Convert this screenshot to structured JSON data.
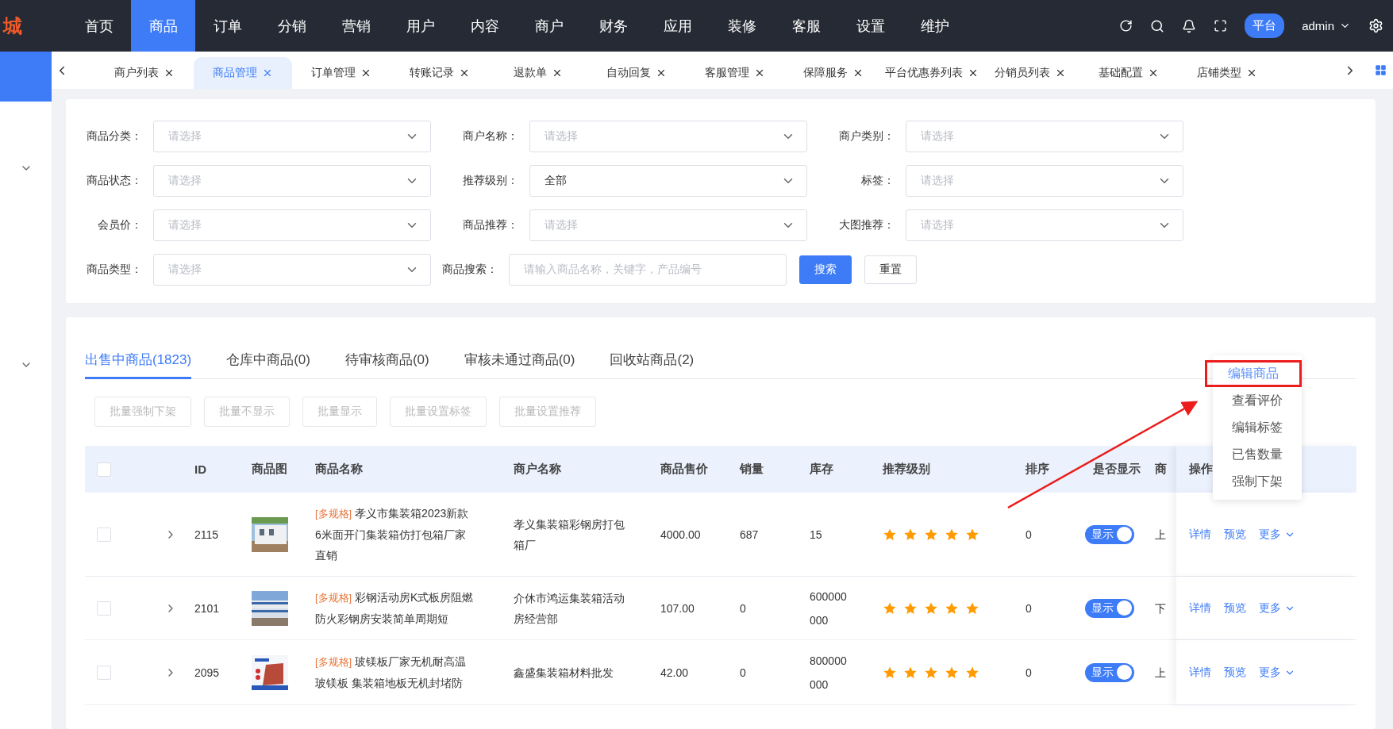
{
  "logo": "城",
  "top_nav": {
    "items": [
      {
        "label": "首页",
        "selected": false
      },
      {
        "label": "商品",
        "selected": true
      },
      {
        "label": "订单",
        "selected": false
      },
      {
        "label": "分销",
        "selected": false
      },
      {
        "label": "营销",
        "selected": false
      },
      {
        "label": "用户",
        "selected": false
      },
      {
        "label": "内容",
        "selected": false
      },
      {
        "label": "商户",
        "selected": false
      },
      {
        "label": "财务",
        "selected": false
      },
      {
        "label": "应用",
        "selected": false
      },
      {
        "label": "装修",
        "selected": false
      },
      {
        "label": "客服",
        "selected": false
      },
      {
        "label": "设置",
        "selected": false
      },
      {
        "label": "维护",
        "selected": false
      }
    ],
    "badge": "平台",
    "user": "admin"
  },
  "page_tabs": [
    {
      "label": "商户列表",
      "selected": false
    },
    {
      "label": "商品管理",
      "selected": true
    },
    {
      "label": "订单管理",
      "selected": false
    },
    {
      "label": "转账记录",
      "selected": false
    },
    {
      "label": "退款单",
      "selected": false
    },
    {
      "label": "自动回复",
      "selected": false
    },
    {
      "label": "客服管理",
      "selected": false
    },
    {
      "label": "保障服务",
      "selected": false
    },
    {
      "label": "平台优惠券列表",
      "selected": false
    },
    {
      "label": "分销员列表",
      "selected": false
    },
    {
      "label": "基础配置",
      "selected": false
    },
    {
      "label": "店铺类型",
      "selected": false
    }
  ],
  "filters": [
    {
      "label": "商品分类：",
      "kind": "select",
      "placeholder": "请选择"
    },
    {
      "label": "商户名称：",
      "kind": "select",
      "placeholder": "请选择"
    },
    {
      "label": "商户类别：",
      "kind": "select",
      "placeholder": "请选择"
    },
    {
      "label": "商品状态：",
      "kind": "select",
      "placeholder": "请选择"
    },
    {
      "label": "推荐级别：",
      "kind": "select",
      "value": "全部"
    },
    {
      "label": "标签：",
      "kind": "select",
      "placeholder": "请选择"
    },
    {
      "label": "会员价：",
      "kind": "select",
      "placeholder": "请选择"
    },
    {
      "label": "商品推荐：",
      "kind": "select",
      "placeholder": "请选择"
    },
    {
      "label": "大图推荐：",
      "kind": "select",
      "placeholder": "请选择"
    },
    {
      "label": "商品类型：",
      "kind": "select",
      "placeholder": "请选择"
    },
    {
      "label": "商品搜索：",
      "kind": "input",
      "placeholder": "请输入商品名称，关键字，产品编号"
    }
  ],
  "filter_buttons": [
    {
      "label": "搜索",
      "kind": "primary"
    },
    {
      "label": "重置",
      "kind": "default"
    }
  ],
  "product_tabs": [
    {
      "label": "出售中商品(1823)",
      "selected": true
    },
    {
      "label": "仓库中商品(0)",
      "selected": false
    },
    {
      "label": "待审核商品(0)",
      "selected": false
    },
    {
      "label": "审核未通过商品(0)",
      "selected": false
    },
    {
      "label": "回收站商品(2)",
      "selected": false
    }
  ],
  "batch_buttons": [
    {
      "label": "批量强制下架",
      "disabled": true
    },
    {
      "label": "批量不显示",
      "disabled": true
    },
    {
      "label": "批量显示",
      "disabled": true
    },
    {
      "label": "批量设置标签",
      "disabled": true
    },
    {
      "label": "批量设置推荐",
      "disabled": true
    }
  ],
  "table": {
    "checked": false,
    "columns": [
      "ID",
      "商品图",
      "商品名称",
      "商户名称",
      "商品售价",
      "销量",
      "库存",
      "推荐级别",
      "排序",
      "是否显示",
      "商",
      "操作"
    ],
    "rows": [
      {
        "checked": false,
        "id": "2115",
        "tag": "[多规格]",
        "name": "孝义市集装箱2023新款6米面开门集装箱仿打包箱厂家直销",
        "merchant": "孝义集装箱彩钢房打包箱厂",
        "price": "4000.00",
        "sales": "687",
        "stock": "15",
        "stars": 5,
        "sort": "0",
        "display": {
          "on": true,
          "label": "显示"
        },
        "column_11": "上",
        "actions": [
          "详情",
          "预览",
          "更多"
        ]
      },
      {
        "checked": false,
        "id": "2101",
        "tag": "[多规格]",
        "name": "彩钢活动房K式板房阻燃防火彩钢房安装简单周期短",
        "merchant": "介休市鸿运集装箱活动房经营部",
        "price": "107.00",
        "sales": "0",
        "stock": "600000000",
        "stars": 5,
        "sort": "0",
        "display": {
          "on": true,
          "label": "显示"
        },
        "column_11": "下",
        "actions": [
          "详情",
          "预览",
          "更多"
        ]
      },
      {
        "checked": false,
        "id": "2095",
        "tag": "[多规格]",
        "name": "玻镁板厂家无机耐高温玻镁板 集装箱地板无机封堵防",
        "merchant": "鑫盛集装箱材料批发",
        "price": "42.00",
        "sales": "0",
        "stock": "800000000",
        "stars": 5,
        "sort": "0",
        "display": {
          "on": true,
          "label": "显示"
        },
        "column_11": "上",
        "actions": [
          "详情",
          "预览",
          "更多"
        ]
      }
    ]
  },
  "more_menu": {
    "items": [
      {
        "label": "编辑商品",
        "highlighted": true
      },
      {
        "label": "查看评价",
        "highlighted": false
      },
      {
        "label": "编辑标签",
        "highlighted": false
      },
      {
        "label": "已售数量",
        "highlighted": false
      },
      {
        "label": "强制下架",
        "highlighted": false
      }
    ]
  }
}
